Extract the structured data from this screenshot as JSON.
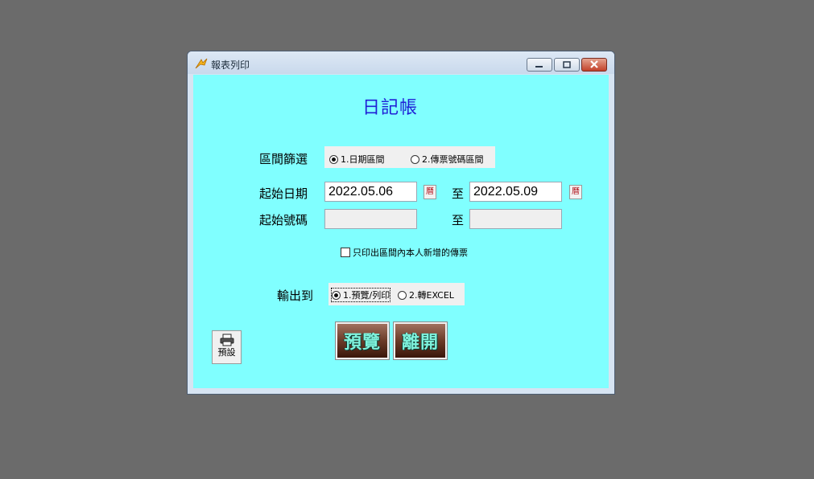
{
  "window": {
    "title": "報表列印",
    "buttons": {
      "minimize": "minimize",
      "maximize": "maximize",
      "close": "close"
    }
  },
  "form": {
    "heading": "日記帳",
    "filter": {
      "label": "區間篩選",
      "options": [
        {
          "label": "1.日期區間",
          "selected": true
        },
        {
          "label": "2.傳票號碼區間",
          "selected": false
        }
      ]
    },
    "date_range": {
      "label": "起始日期",
      "from": "2022.05.06",
      "to_label": "至",
      "to": "2022.05.09",
      "calendar_button": "曆"
    },
    "number_range": {
      "label": "起始號碼",
      "from": "",
      "to_label": "至",
      "to": ""
    },
    "only_mine": {
      "label": "只印出區間內本人新增的傳票",
      "checked": false
    },
    "output": {
      "label": "輸出到",
      "options": [
        {
          "label": "1.預覽/列印",
          "selected": true
        },
        {
          "label": "2.轉EXCEL",
          "selected": false
        }
      ]
    },
    "actions": {
      "preview": "預覽",
      "exit": "離開",
      "default": "預設"
    }
  },
  "colors": {
    "desktop": "#6b6b6b",
    "client_background": "#80ffff",
    "heading": "#1f1fd6",
    "button_text": "#7ff2dc"
  },
  "icons": [
    "app-icon",
    "minimize-icon",
    "maximize-icon",
    "close-icon",
    "calendar-icon",
    "printer-icon"
  ]
}
